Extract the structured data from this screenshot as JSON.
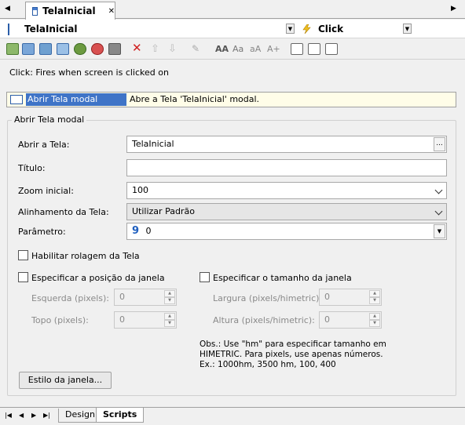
{
  "tabbar": {
    "tab_title": "TelaInicial",
    "close": "✕",
    "nav_left": "◀",
    "nav_right": "▶"
  },
  "header": {
    "object_name": "TelaInicial",
    "event_name": "Click"
  },
  "event_description": "Click: Fires when screen is clicked on",
  "action": {
    "name": "Abrir Tela modal",
    "description": "Abre a Tela 'TelaInicial' modal."
  },
  "group": {
    "title": "Abrir Tela modal",
    "abrir_tela_label": "Abrir a Tela:",
    "abrir_tela_value": "TelaInicial",
    "browse_label": "...",
    "titulo_label": "Título:",
    "titulo_value": "",
    "zoom_label": "Zoom inicial:",
    "zoom_value": "100",
    "alinhamento_label": "Alinhamento da Tela:",
    "alinhamento_value": "Utilizar Padrão",
    "parametro_label": "Parâmetro:",
    "parametro_icon": "9",
    "parametro_value": "0",
    "rolagem_label": "Habilitar rolagem da Tela",
    "posicao_label": "Especificar a posição da janela",
    "esquerda_label": "Esquerda (pixels):",
    "esquerda_value": "0",
    "topo_label": "Topo (pixels):",
    "topo_value": "0",
    "tamanho_label": "Especificar o tamanho da janela",
    "largura_label": "Largura (pixels/himetric):",
    "largura_value": "0",
    "altura_label": "Altura (pixels/himetric):",
    "altura_value": "0",
    "obs_line1": "Obs.: Use \"hm\" para especificar tamanho em",
    "obs_line2": "HIMETRIC. Para pixels, use apenas números.",
    "obs_line3": "Ex.: 1000hm, 3500 hm, 100, 400",
    "estilo_button": "Estilo da janela..."
  },
  "bottom_tabs": {
    "design": "Design",
    "scripts": "Scripts"
  },
  "colors": {
    "selection": "#3f74c7",
    "action_row_bg": "#fffde8",
    "parametro_icon": "#1f5fbf",
    "delete_icon": "#d02020"
  }
}
